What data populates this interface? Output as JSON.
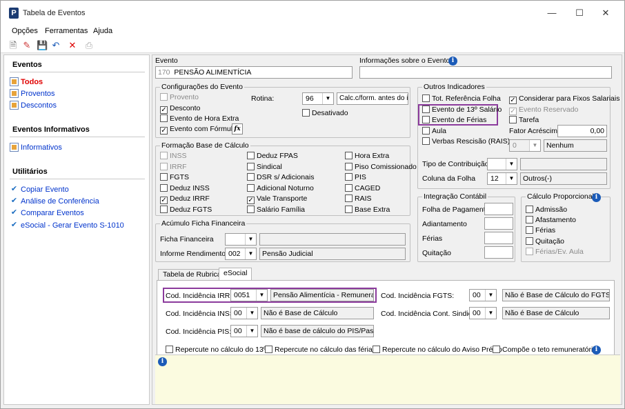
{
  "window": {
    "title": "Tabela de Eventos"
  },
  "menu": [
    "Opções",
    "Ferramentas",
    "Ajuda"
  ],
  "sidebar": {
    "sections": [
      {
        "title": "Eventos",
        "items": [
          "Todos",
          "Proventos",
          "Descontos"
        ]
      },
      {
        "title": "Eventos Informativos",
        "items": [
          "Informativos"
        ]
      },
      {
        "title": "Utilitários",
        "items": [
          "Copiar Evento",
          "Análise de Conferência",
          "Comparar Eventos",
          "eSocial - Gerar Evento S-1010"
        ]
      }
    ]
  },
  "evento": {
    "label": "Evento",
    "code": "170",
    "name": "PENSÃO ALIMENTÍCIA",
    "info_label": "Informações sobre o Evento"
  },
  "config": {
    "title": "Configurações do Evento",
    "provento": "Provento",
    "desconto": "Desconto",
    "hora_extra": "Evento de Hora Extra",
    "com_formula": "Evento com Fórmula",
    "rotina_label": "Rotina:",
    "rotina_value": "96",
    "rotina_desc": "Calc.c/form. antes do irf",
    "desativado": "Desativado",
    "fx": "fx"
  },
  "formacao": {
    "title": "Formação Base de Cálculo",
    "col1": [
      "INSS",
      "IRRF",
      "FGTS",
      "Deduz INSS",
      "Deduz IRRF",
      "Deduz FGTS"
    ],
    "col2": [
      "Deduz FPAS",
      "Sindical",
      "DSR s/ Adicionais",
      "Adicional Noturno",
      "Vale Transporte",
      "Salário Família"
    ],
    "col3": [
      "Hora Extra",
      "Piso Comissionado",
      "PIS",
      "CAGED",
      "RAIS",
      "Base Extra"
    ]
  },
  "acumulo": {
    "title": "Acúmulo Ficha Financeira",
    "ficha_label": "Ficha Financeira",
    "informe_label": "Informe Rendimentos",
    "informe_value": "002",
    "informe_desc": "Pensão Judicial"
  },
  "outros": {
    "title": "Outros Indicadores",
    "tot_ref": "Tot. Referência Folha",
    "decimo": "Evento de 13º Salário",
    "ferias": "Evento de Férias",
    "aula": "Aula",
    "verbas": "Verbas Rescisão (RAIS)",
    "fixos": "Considerar para Fixos Salariais",
    "reservado": "Evento Reservado",
    "tarefa": "Tarefa",
    "fator_label": "Fator Acréscimo",
    "fator_value": "0,00",
    "verbas_value": "0",
    "verbas_desc": "Nenhum",
    "tipo_contrib": "Tipo de Contribuição",
    "coluna_label": "Coluna da Folha",
    "coluna_value": "12",
    "coluna_desc": "Outros(-)"
  },
  "integracao": {
    "title": "Integração Contábil",
    "items": [
      "Folha de Pagamento",
      "Adiantamento",
      "Férias",
      "Quitação"
    ]
  },
  "proporcional": {
    "title": "Cálculo Proporcional",
    "items": [
      "Admissão",
      "Afastamento",
      "Férias",
      "Quitação",
      "Férias/Ev. Aula"
    ]
  },
  "tabs": [
    "Tabela de Rubricas",
    "eSocial"
  ],
  "esocial": {
    "irrf_label": "Cod. Incidência IRRF:",
    "irrf_value": "0051",
    "irrf_desc": "Pensão Alimentícia - Remuneração Mensal",
    "inss_label": "Cod. Incidência INSS:",
    "inss_value": "00",
    "inss_desc": "Não é Base de Cálculo",
    "pis_label": "Cod. Incidência PIS:",
    "pis_value": "00",
    "pis_desc": "Não é base de cálculo do PIS/Pasep",
    "fgts_label": "Cod. Incidência FGTS:",
    "fgts_value": "00",
    "fgts_desc": "Não é Base de Cálculo do FGTS",
    "sind_label": "Cod. Incidência Cont. Sindical:",
    "sind_value": "00",
    "sind_desc": "Não é Base de Cálculo",
    "rep13": "Repercute no cálculo do 13º",
    "repferias": "Repercute no cálculo das férias",
    "repaviso": "Repercute no cálculo do Aviso Prévio",
    "teto": "Compõe o teto remuneratório"
  }
}
